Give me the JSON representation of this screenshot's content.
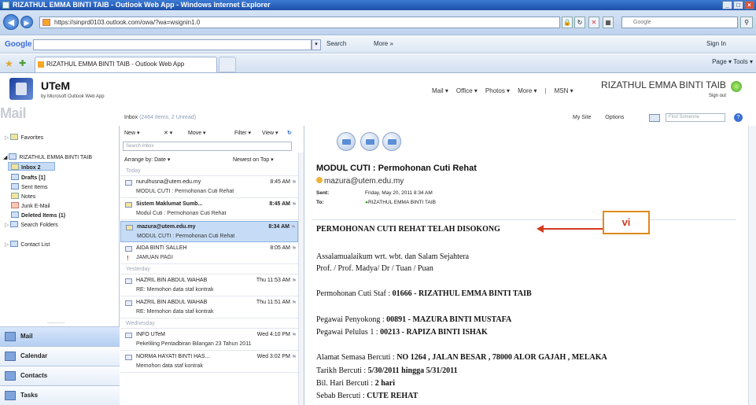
{
  "window": {
    "title": "RIZATHUL EMMA BINTI TAIB - Outlook Web App - Windows Internet Explorer",
    "controls": [
      "_",
      "□",
      "×"
    ]
  },
  "browser": {
    "url": "https://sinprd0103.outlook.com/owa/?wa=wsignin1.0",
    "search_placeholder": "Google",
    "google_toolbar": {
      "logo": "Google",
      "search_label": "Search",
      "more_label": "More »",
      "signin_label": "Sign In"
    },
    "tab_title": "RIZATHUL EMMA BINTI TAIB - Outlook Web App",
    "command_bar": "Page ▾   Tools ▾"
  },
  "owa": {
    "brand": "UTeM",
    "brand_sub": "by Microsoft Outlook Web App",
    "top_nav": [
      "Mail ▾",
      "Office ▾",
      "Photos ▾",
      "More ▾",
      "|",
      "MSN ▾"
    ],
    "user_name": "RIZATHUL EMMA BINTI TAIB",
    "sign_out": "Sign out",
    "section_title": "Mail",
    "inbox_count_label": "Inbox",
    "inbox_count_detail": "(2464 Items, 2 Unread)",
    "my_site": "My Site",
    "options": "Options",
    "find_someone": "Find Someone"
  },
  "leftnav": {
    "favorites": "Favorites",
    "account": "RIZATHUL EMMA BINTI TAIB",
    "folders": [
      {
        "label": "Inbox",
        "count": "2",
        "bold": true
      },
      {
        "label": "Drafts",
        "count": "[1]",
        "bold": true
      },
      {
        "label": "Sent Items",
        "count": "",
        "bold": false
      },
      {
        "label": "Notes",
        "count": "",
        "bold": false
      },
      {
        "label": "Junk E-Mail",
        "count": "",
        "bold": false
      },
      {
        "label": "Deleted Items",
        "count": "(1)",
        "bold": true
      },
      {
        "label": "Search Folders",
        "count": "",
        "bold": false
      }
    ],
    "contact_list": "Contact List",
    "dots": "..........",
    "bottom": [
      "Mail",
      "Calendar",
      "Contacts",
      "Tasks"
    ]
  },
  "list": {
    "toolbar": {
      "new": "New ▾",
      "delete": "✕ ▾",
      "move": "Move ▾",
      "filter": "Filter ▾",
      "view": "View ▾"
    },
    "search_placeholder": "Search Inbox",
    "arrange": "Arrange by: Date ▾",
    "order": "Newest on Top ▾",
    "groups": [
      "Today",
      "Yesterday",
      "Wednesday"
    ],
    "messages": [
      {
        "from": "nurulhusna@utem.edu.my",
        "subject": "MODUL CUTI : Permohonan Cuti Rehat",
        "time": "8:45 AM",
        "unread": false
      },
      {
        "from": "Sistem Maklumat Sumb...",
        "subject": "Modul Cuti : Permohonan Cuti Rehat",
        "time": "8:45 AM",
        "unread": true
      },
      {
        "from": "mazura@utem.edu.my",
        "subject": "MODUL CUTI : Permohonan Cuti Rehat",
        "time": "8:34 AM",
        "unread": true
      },
      {
        "from": "AIDA BINTI SALLEH",
        "subject": "JAMUAN PAGI",
        "time": "8:05 AM",
        "unread": false
      },
      {
        "from": "HAZRIL BIN ABDUL WAHAB",
        "subject": "RE: Memohon data staf kontrak",
        "time": "Thu 11:53 AM",
        "unread": false
      },
      {
        "from": "HAZRIL BIN ABDUL WAHAB",
        "subject": "RE: Memohon data staf kontrak",
        "time": "Thu 11:51 AM",
        "unread": false
      },
      {
        "from": "INFO UTeM",
        "subject": "Pekeliling Pentadbiran Bilangan 23 Tahun 2011",
        "time": "Wed 4:10 PM",
        "unread": false
      },
      {
        "from": "NORMA HAYATI BINTI HAS...",
        "subject": "Memohon data staf kontrak",
        "time": "Wed 3:02 PM",
        "unread": false
      }
    ]
  },
  "reading": {
    "subject": "MODUL CUTI : Permohonan Cuti Rehat",
    "from": "mazura@utem.edu.my",
    "sent_label": "Sent:",
    "sent_value": "Friday, May 20, 2011 8:34 AM",
    "to_label": "To:",
    "to_value": "RIZATHUL EMMA BINTI TAIB",
    "callout": "vi",
    "body": [
      {
        "text": "PERMOHONAN CUTI REHAT TELAH DISOKONG",
        "bold_part": ""
      },
      {
        "text": "Assalamualaikum wrt. wbt. dan Salam Sejahtera",
        "bold_part": ""
      },
      {
        "text": "Prof. / Prof. Madya/ Dr / Tuan / Puan",
        "bold_part": ""
      },
      {
        "text": "Permohonan Cuti Staf : ",
        "bold_part": "01666 - RIZATHUL EMMA BINTI TAIB"
      },
      {
        "text": "Pegawai Penyokong : ",
        "bold_part": "00891 - MAZURA BINTI MUSTAFA"
      },
      {
        "text": "Pegawai Pelulus 1 : ",
        "bold_part": "00213 - RAPIZA BINTI ISHAK"
      },
      {
        "text": "Alamat Semasa Bercuti : ",
        "bold_part": "NO 1264 , JALAN BESAR , 78000 ALOR GAJAH , MELAKA"
      },
      {
        "text": "Tarikh Bercuti : ",
        "bold_part": "5/30/2011 hingga 5/31/2011"
      },
      {
        "text": "Bil. Hari Bercuti : ",
        "bold_part": "2 hari"
      },
      {
        "text": "Sebab Bercuti : ",
        "bold_part": "CUTE REHAT"
      }
    ]
  }
}
